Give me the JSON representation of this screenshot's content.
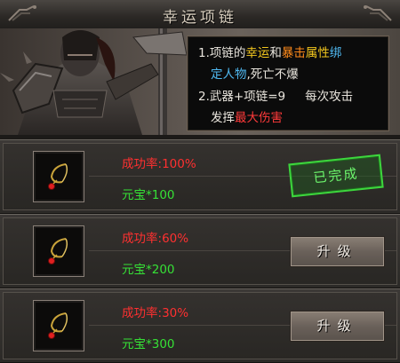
{
  "window": {
    "title": "幸运项链"
  },
  "description": {
    "line1": {
      "prefix": "1.项链的",
      "luck": "幸运",
      "and": "和",
      "crit": "暴击",
      "attr": "属性",
      "bind_a": "绑"
    },
    "line2": {
      "bind_b": "定人物",
      "comma": ",",
      "no_drop": "死亡不爆"
    },
    "line3": {
      "text": "2.武器+项链=9",
      "gap": "每次攻击"
    },
    "line4": {
      "prefix": "发挥",
      "max_dmg": "最大伤害"
    }
  },
  "rows": [
    {
      "rate_label": "成功率:",
      "rate": "100%",
      "cost_label": "元宝*",
      "cost": "100",
      "status": "已完成",
      "action": ""
    },
    {
      "rate_label": "成功率:",
      "rate": "60%",
      "cost_label": "元宝*",
      "cost": "200",
      "status": "",
      "action": "升级"
    },
    {
      "rate_label": "成功率:",
      "rate": "30%",
      "cost_label": "元宝*",
      "cost": "300",
      "status": "",
      "action": "升级"
    }
  ],
  "icons": {
    "item": "necklace-icon",
    "corner": "ornament-icon"
  },
  "colors": {
    "success_rate": "#ff3030",
    "cost": "#36e036",
    "done_stamp": "#3dd63d",
    "luck": "#f2c61e",
    "crit": "#ff8a1a",
    "bind": "#4fb8f0"
  }
}
